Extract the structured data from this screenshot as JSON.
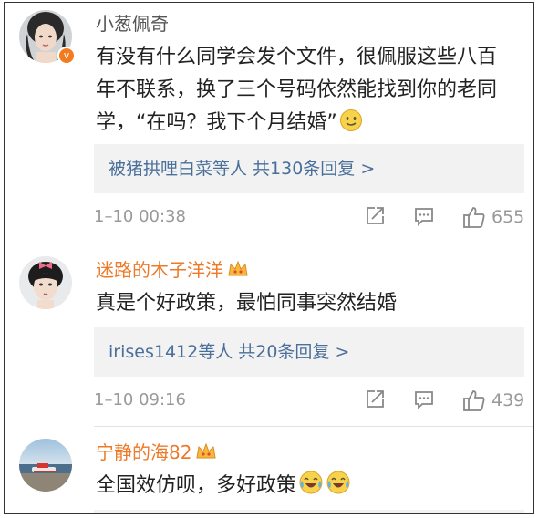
{
  "comments": [
    {
      "username": "小葱佩奇",
      "badge": "v",
      "text": "有没有什么同学会发个文件，很佩服这些八百年不联系，换了三个号码依然能找到你的老同学，“在吗？我下个月结婚”",
      "reply_summary": "被猪拱哩白菜等人 共130条回复 >",
      "timestamp": "1–10 00:38",
      "likes": "655"
    },
    {
      "username": "迷路的木子洋洋",
      "text": "真是个好政策，最怕同事突然结婚",
      "reply_summary": "irises1412等人 共20条回复 >",
      "timestamp": "1–10 09:16",
      "likes": "439"
    },
    {
      "username": "宁静的海82",
      "text": "全国效仿呗，多好政策"
    }
  ],
  "colors": {
    "username_gray": "#555555",
    "username_vip": "#ec7a2a",
    "reply_link": "#4a6f9b",
    "meta_gray": "#999999",
    "reply_bg": "#f2f2f2"
  }
}
